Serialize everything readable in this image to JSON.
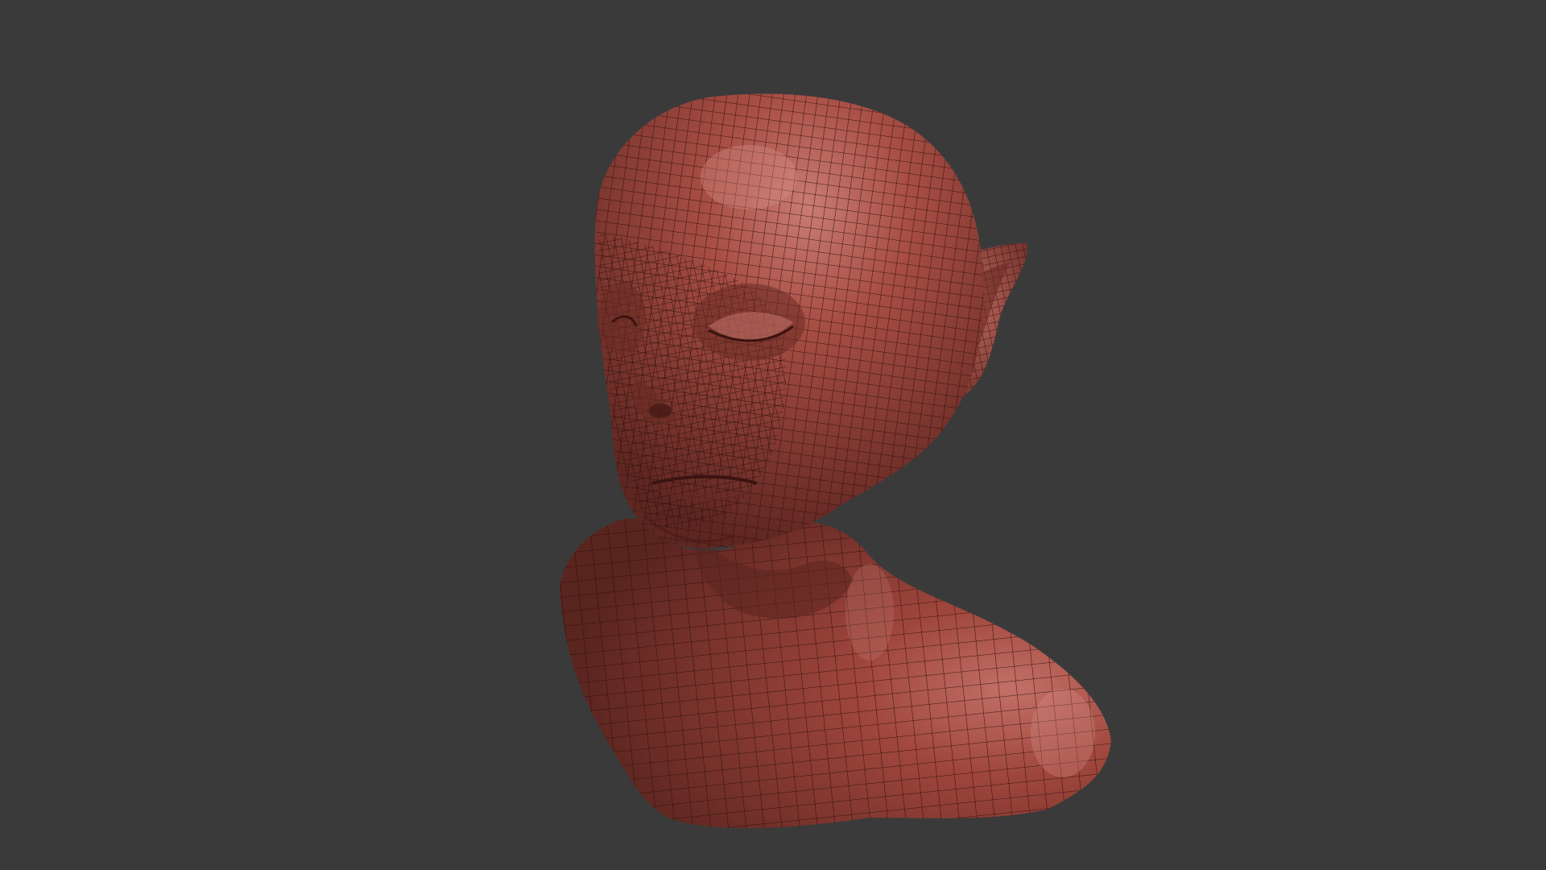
{
  "scene": {
    "background_color": "#3a3a3a",
    "model": {
      "subject": "creature-head-bust",
      "display_mode": "shaded-wireframe",
      "surface_color": "#a34a40",
      "highlight_color": "#c77a72",
      "shadow_color": "#5e2621",
      "wire_color": "#2a0e0b"
    }
  }
}
